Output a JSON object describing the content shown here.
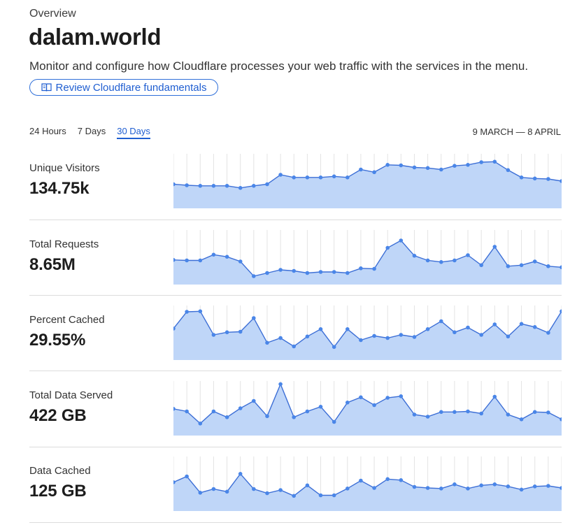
{
  "header": {
    "eyebrow": "Overview",
    "title": "dalam.world",
    "description": "Monitor and configure how Cloudflare processes your web traffic with the services in the menu.",
    "fundamentals_label": "Review Cloudflare fundamentals"
  },
  "time_tabs": [
    {
      "label": "24 Hours",
      "active": false
    },
    {
      "label": "7 Days",
      "active": false
    },
    {
      "label": "30 Days",
      "active": true
    }
  ],
  "date_range": "9 MARCH — 8 APRIL",
  "colors": {
    "accent": "#1f5ed1",
    "line": "#3d6fd6",
    "dot": "#4a86e8",
    "fill": "#bfd6f8"
  },
  "metrics": [
    {
      "label": "Unique Visitors",
      "value": "134.75k"
    },
    {
      "label": "Total Requests",
      "value": "8.65M"
    },
    {
      "label": "Percent Cached",
      "value": "29.55%"
    },
    {
      "label": "Total Data Served",
      "value": "422 GB"
    },
    {
      "label": "Data Cached",
      "value": "125 GB"
    }
  ],
  "chart_data": [
    {
      "type": "area",
      "series": [
        {
          "values": [
            46,
            44,
            43,
            43,
            43,
            39,
            43,
            46,
            64,
            59,
            59,
            59,
            61,
            59,
            74,
            69,
            83,
            82,
            78,
            77,
            74,
            81,
            83,
            88,
            89,
            73,
            59,
            57,
            56,
            52
          ]
        }
      ]
    },
    {
      "type": "area",
      "series": [
        {
          "values": [
            47,
            46,
            46,
            57,
            53,
            44,
            16,
            22,
            28,
            26,
            22,
            24,
            24,
            22,
            31,
            30,
            70,
            84,
            55,
            46,
            43,
            46,
            56,
            37,
            72,
            35,
            37,
            44,
            35,
            33
          ]
        }
      ]
    },
    {
      "type": "area",
      "series": [
        {
          "values": [
            60,
            92,
            93,
            48,
            53,
            54,
            80,
            33,
            42,
            26,
            45,
            59,
            25,
            59,
            38,
            46,
            42,
            48,
            44,
            59,
            74,
            53,
            62,
            48,
            68,
            45,
            69,
            63,
            52,
            93
          ]
        }
      ]
    },
    {
      "type": "area",
      "series": [
        {
          "values": [
            51,
            46,
            23,
            46,
            35,
            52,
            66,
            37,
            98,
            35,
            46,
            55,
            26,
            63,
            73,
            58,
            72,
            75,
            40,
            36,
            45,
            45,
            46,
            42,
            74,
            40,
            31,
            45,
            44,
            31
          ]
        }
      ]
    },
    {
      "type": "area",
      "series": [
        {
          "values": [
            55,
            66,
            35,
            42,
            37,
            71,
            42,
            34,
            40,
            29,
            49,
            30,
            30,
            43,
            58,
            44,
            61,
            59,
            46,
            44,
            43,
            51,
            43,
            49,
            51,
            47,
            41,
            47,
            48,
            44
          ]
        }
      ]
    }
  ]
}
